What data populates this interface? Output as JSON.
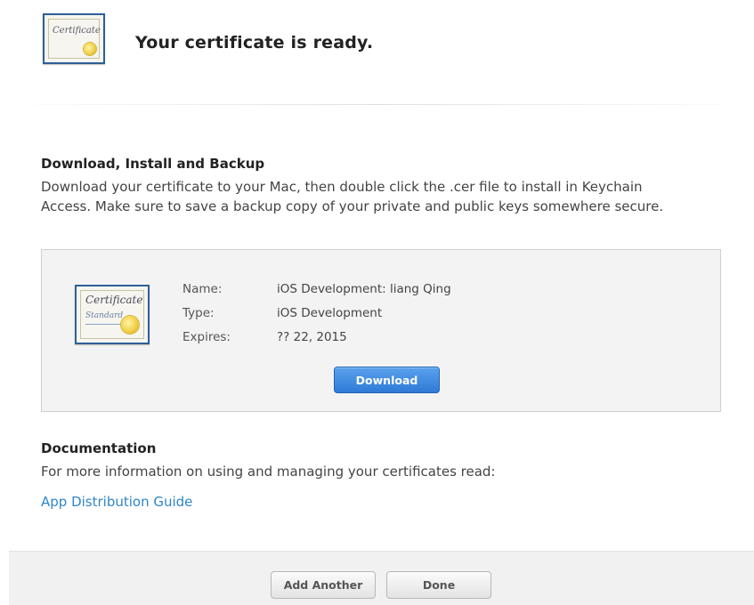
{
  "header": {
    "title": "Your certificate is ready.",
    "icon": "certificate-icon",
    "icon_text": "Certificate"
  },
  "download_section": {
    "heading": "Download, Install and Backup",
    "description_line1": "Download your certificate to your Mac, then double click the .cer file to install in Keychain",
    "description_line2": "Access. Make sure to save a backup copy of your private and public keys somewhere secure."
  },
  "certificate": {
    "icon": "certificate-standard-icon",
    "icon_text": "Certificate",
    "icon_subtext": "Standard",
    "fields": [
      {
        "label": "Name:",
        "value": "iOS Development: liang Qing"
      },
      {
        "label": "Type:",
        "value": "iOS Development"
      },
      {
        "label": "Expires:",
        "value": "?? 22, 2015"
      }
    ],
    "download_label": "Download"
  },
  "documentation": {
    "heading": "Documentation",
    "description": "For more information on using and managing your certificates read:",
    "link_label": "App Distribution Guide"
  },
  "footer": {
    "add_another_label": "Add Another",
    "done_label": "Done"
  },
  "colors": {
    "link": "#2f86c9",
    "primary_button": "#2f7ad6",
    "certificate_border": "#2e5f97",
    "seal": "#f1d04a"
  }
}
